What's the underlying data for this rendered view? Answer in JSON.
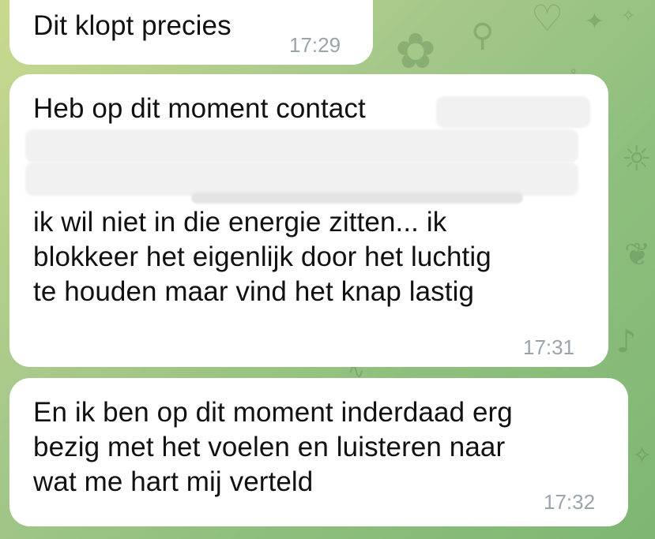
{
  "chat": {
    "background_colors": [
      "#c9d98f",
      "#7fb673"
    ],
    "bubble_color": "#ffffff",
    "messages": [
      {
        "text": "Dit klopt precies",
        "time": "17:29"
      },
      {
        "first_line": "Heb op dit moment contact",
        "rest": "ik wil niet in die energie zitten... ik\nblokkeer het eigenlijk door het luchtig\nte houden maar vind het knap lastig",
        "time": "17:31"
      },
      {
        "text": "En ik ben op dit moment inderdaad erg\nbezig met het voelen en luisteren naar\nwat me hart mij verteld",
        "time": "17:32"
      }
    ]
  }
}
